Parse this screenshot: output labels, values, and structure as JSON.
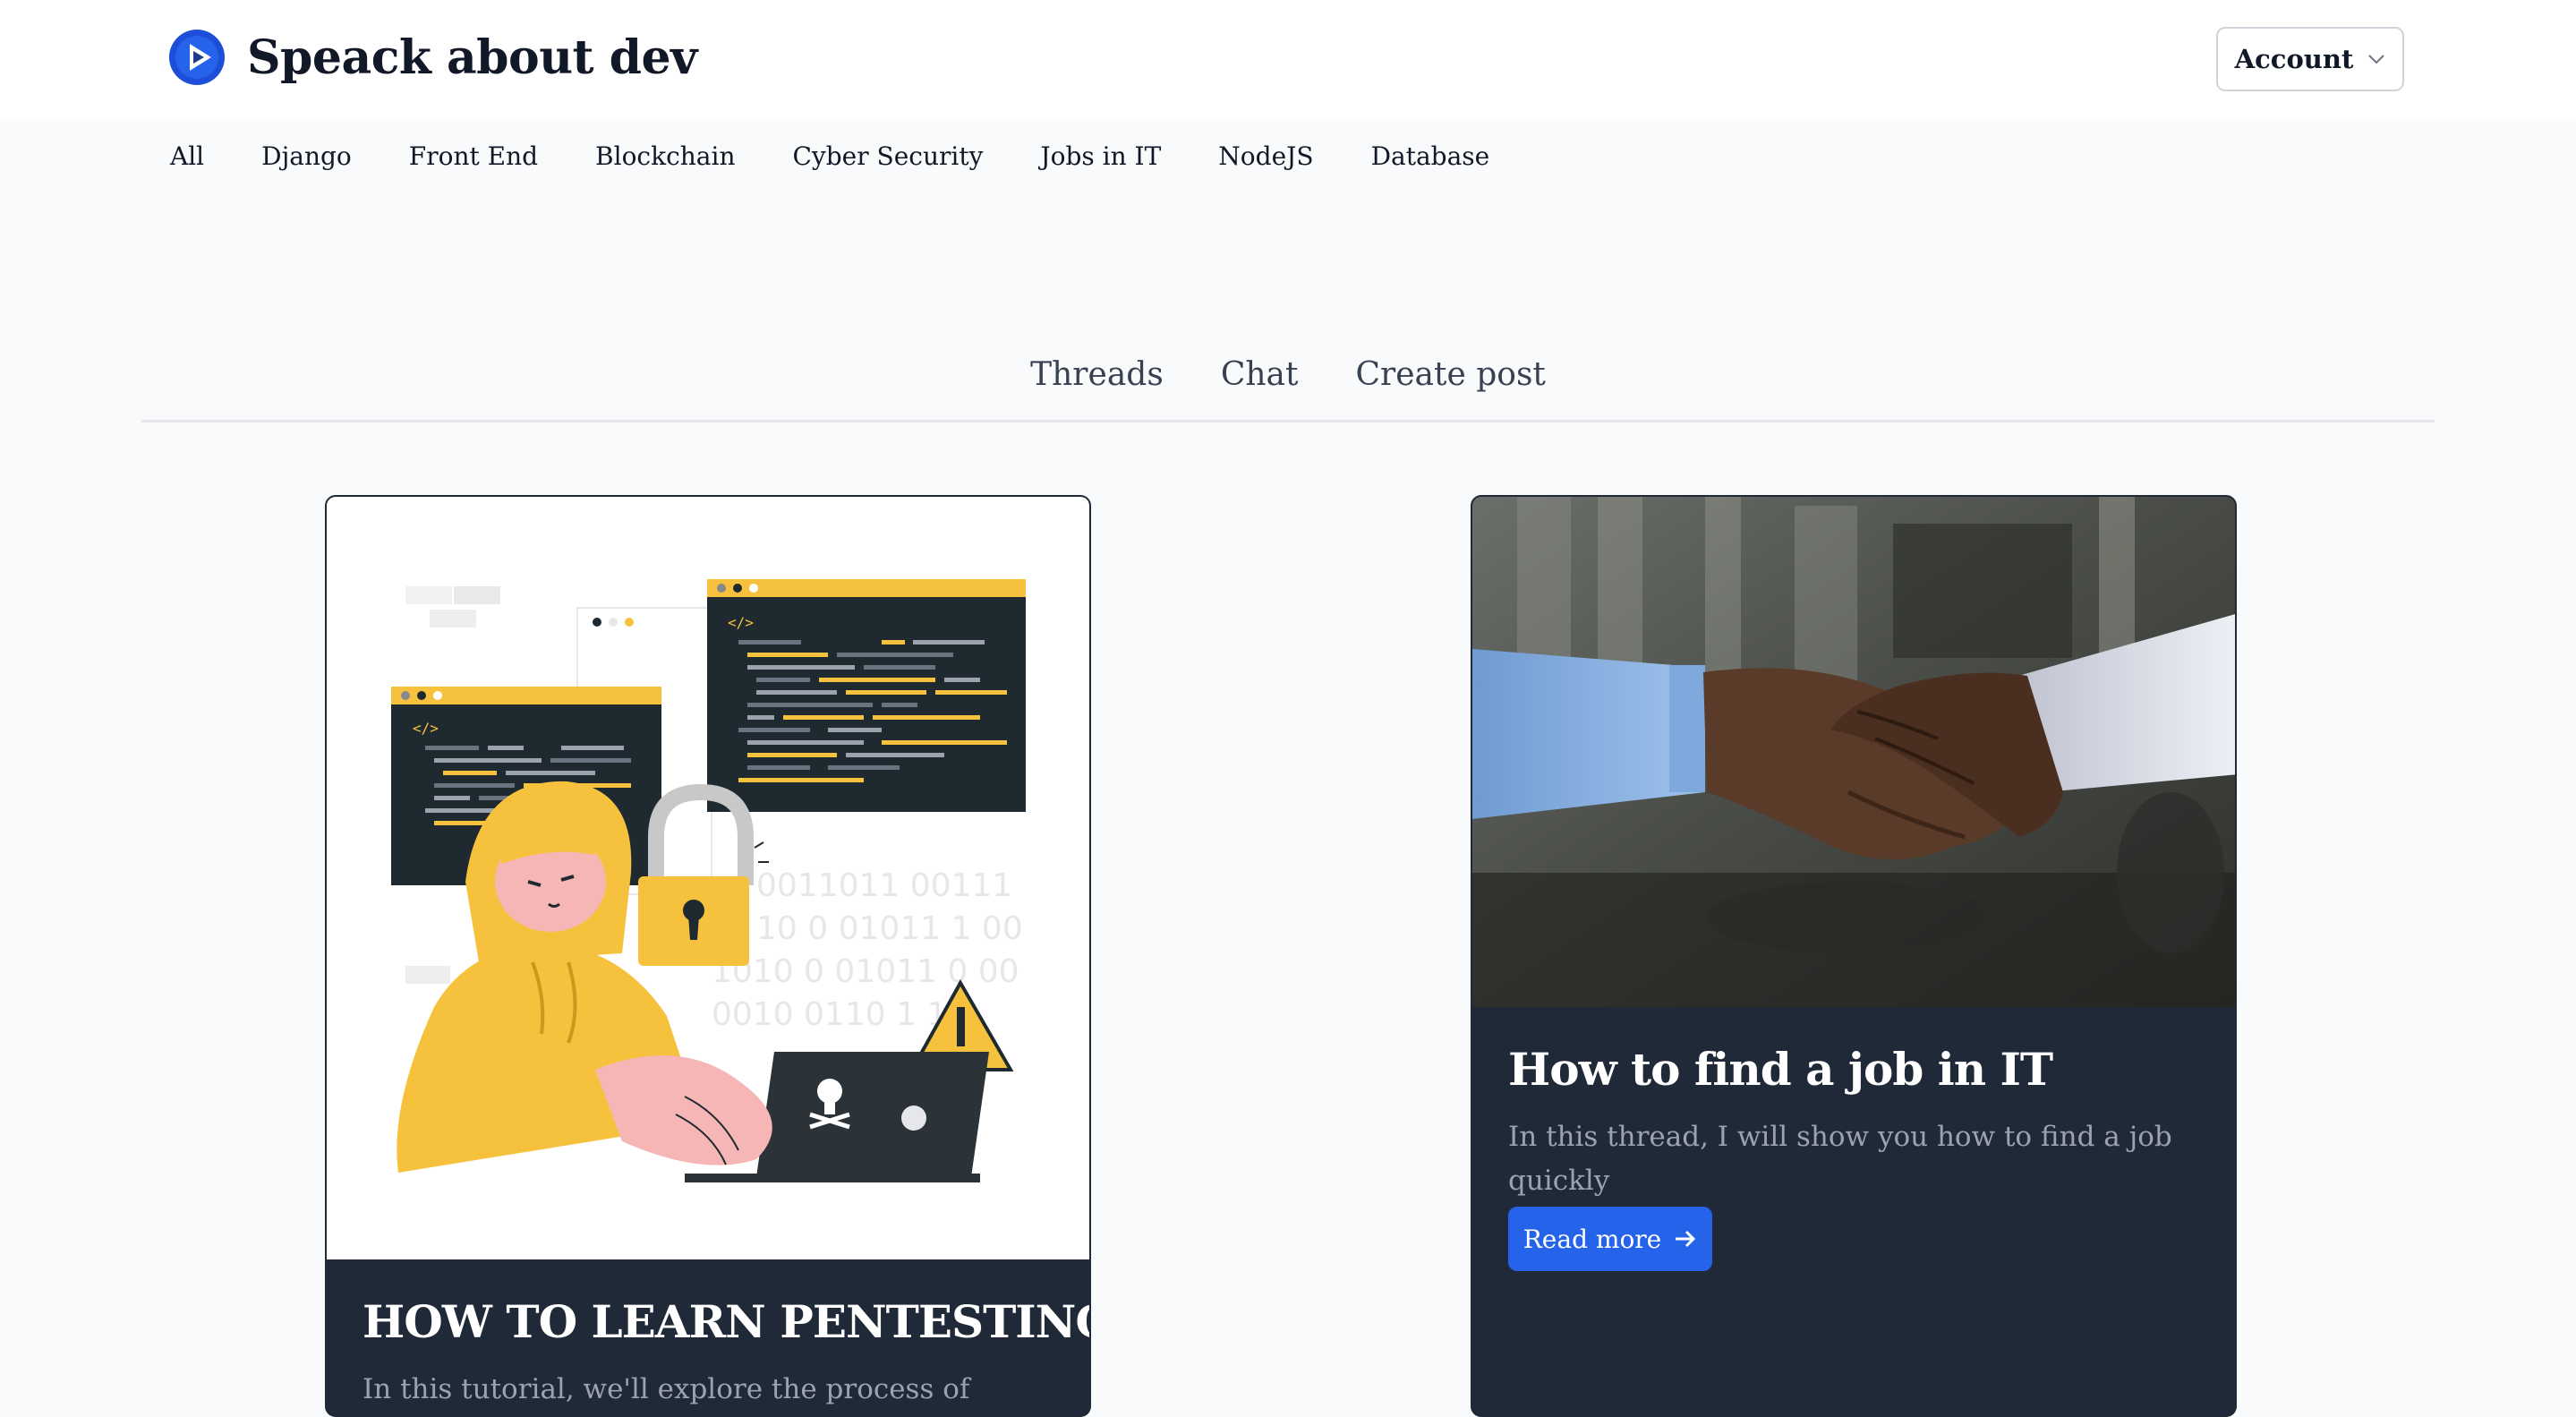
{
  "brand": {
    "title": "Speack about dev",
    "logo_icon": "play-circle-icon",
    "accent": "#2563eb"
  },
  "header": {
    "account_label": "Account",
    "account_icon": "chevron-down-icon"
  },
  "categories": [
    "All",
    "Django",
    "Front End",
    "Blockchain",
    "Cyber Security",
    "Jobs in IT",
    "NodeJS",
    "Database"
  ],
  "tabs": [
    "Threads",
    "Chat",
    "Create post"
  ],
  "posts": [
    {
      "title": "HOW TO LEARN PENTESTING",
      "description": "In this tutorial, we'll explore the process of learning",
      "image": "hacker-illustration"
    },
    {
      "title": "How to find a job in IT",
      "description": "In this thread, I will show you how to find a job quickly",
      "image": "handshake-photo",
      "read_more_label": "Read more",
      "read_more_icon": "arrow-right-icon"
    }
  ]
}
